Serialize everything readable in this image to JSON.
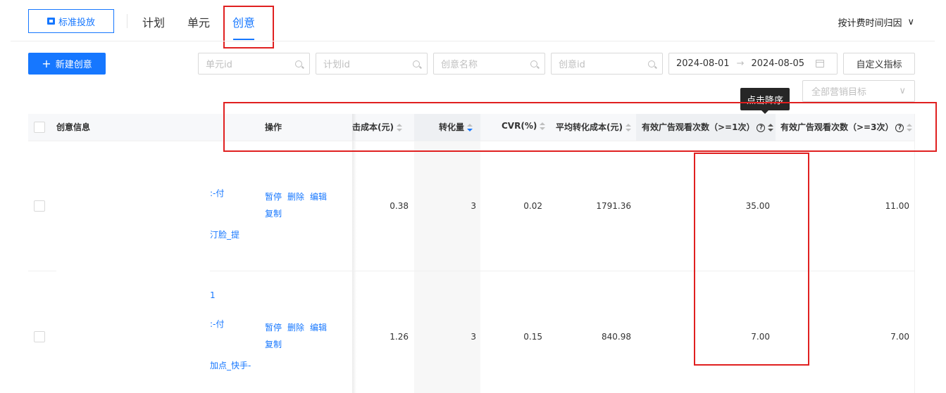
{
  "topbar": {
    "standard_button": "标准投放",
    "tabs": [
      "计划",
      "单元",
      "创意"
    ],
    "active_tab": "创意",
    "attribution_label": "按计费时间归因",
    "attribution_chevron": "∨"
  },
  "toolbar": {
    "new_button": "新建创意",
    "new_button_icon": "+",
    "filters": {
      "unit_id_placeholder": "单元id",
      "plan_id_placeholder": "计划id",
      "creative_name_placeholder": "创意名称",
      "creative_id_placeholder": "创意id"
    },
    "date_start": "2024-08-01",
    "date_arrow": "→",
    "date_end": "2024-08-05",
    "custom_metrics_button": "自定义指标",
    "goal_select_placeholder": "全部营销目标",
    "goal_select_chevron": "∨"
  },
  "tooltip": "点击降序",
  "table": {
    "headers": {
      "creative_info": "创意信息",
      "operation": "操作",
      "click_cost": "击成本(元)",
      "conversions": "转化量",
      "cvr": "CVR(%)",
      "avg_conv_cost": "平均转化成本(元)",
      "valid_views_1": "有效广告观看次数（>=1次）",
      "valid_views_3": "有效广告观看次数（>=3次）",
      "help_glyph": "?"
    },
    "rows": [
      {
        "info_lines": [
          ":-付",
          "汀脸_提"
        ],
        "ops_line1": [
          "暂停",
          "删除",
          "编辑"
        ],
        "ops_line2": "复制",
        "click_cost": "0.38",
        "conversions": "3",
        "cvr": "0.02",
        "avg_conv_cost": "1791.36",
        "valid_views_1": "35.00",
        "valid_views_3": "11.00"
      },
      {
        "info_lines": [
          "1",
          ":-付",
          "加点_快手-"
        ],
        "ops_line1": [
          "暂停",
          "删除",
          "编辑"
        ],
        "ops_line2": "复制",
        "click_cost": "1.26",
        "conversions": "3",
        "cvr": "0.15",
        "avg_conv_cost": "840.98",
        "valid_views_1": "7.00",
        "valid_views_3": "7.00"
      }
    ]
  },
  "colors": {
    "primary": "#1677ff",
    "highlight_red": "#e02020"
  }
}
